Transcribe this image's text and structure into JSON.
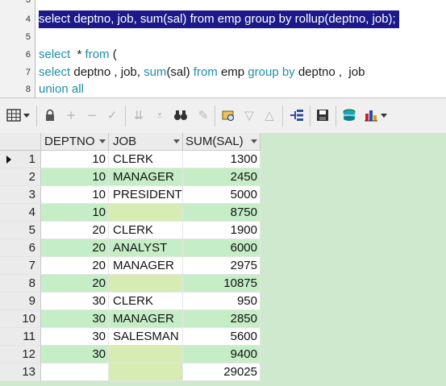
{
  "editor": {
    "lines": [
      {
        "num": "3",
        "text": ""
      },
      {
        "num": "4",
        "text": "select deptno, job, sum(sal) from emp group by rollup(deptno, job);"
      },
      {
        "num": "5",
        "text": ""
      },
      {
        "num": "6",
        "text_parts": [
          "select",
          "  * ",
          "from",
          " ("
        ]
      },
      {
        "num": "7",
        "text_parts": [
          "select",
          " deptno , job, ",
          "sum",
          "(sal) ",
          "from",
          " emp ",
          "group by",
          " deptno ,  job"
        ]
      },
      {
        "num": "8",
        "text_parts": [
          "union all"
        ]
      }
    ]
  },
  "toolbar": {
    "icons": [
      "grid-view-icon",
      "dropdown-arrow-icon",
      "lock-icon",
      "add-record-icon",
      "delete-record-icon",
      "post-edit-icon",
      "filter-down-icon",
      "filter-clear-icon",
      "find-binoculars-icon",
      "clear-icon",
      "query-by-example-icon",
      "sort-desc-icon",
      "sort-asc-icon",
      "tree-view-icon",
      "save-icon",
      "export-icon",
      "chart-icon",
      "chart-dropdown-icon"
    ]
  },
  "grid": {
    "columns": [
      "DEPTNO",
      "JOB",
      "SUM(SAL)"
    ],
    "rows": [
      {
        "n": "1",
        "deptno": "10",
        "job": "CLERK",
        "sal": "1300"
      },
      {
        "n": "2",
        "deptno": "10",
        "job": "MANAGER",
        "sal": "2450"
      },
      {
        "n": "3",
        "deptno": "10",
        "job": "PRESIDENT",
        "sal": "5000"
      },
      {
        "n": "4",
        "deptno": "10",
        "job": "",
        "sal": "8750"
      },
      {
        "n": "5",
        "deptno": "20",
        "job": "CLERK",
        "sal": "1900"
      },
      {
        "n": "6",
        "deptno": "20",
        "job": "ANALYST",
        "sal": "6000"
      },
      {
        "n": "7",
        "deptno": "20",
        "job": "MANAGER",
        "sal": "2975"
      },
      {
        "n": "8",
        "deptno": "20",
        "job": "",
        "sal": "10875"
      },
      {
        "n": "9",
        "deptno": "30",
        "job": "CLERK",
        "sal": "950"
      },
      {
        "n": "10",
        "deptno": "30",
        "job": "MANAGER",
        "sal": "2850"
      },
      {
        "n": "11",
        "deptno": "30",
        "job": "SALESMAN",
        "sal": "5600"
      },
      {
        "n": "12",
        "deptno": "30",
        "job": "",
        "sal": "9400"
      },
      {
        "n": "13",
        "deptno": "",
        "job": "",
        "sal": "29025"
      }
    ]
  }
}
